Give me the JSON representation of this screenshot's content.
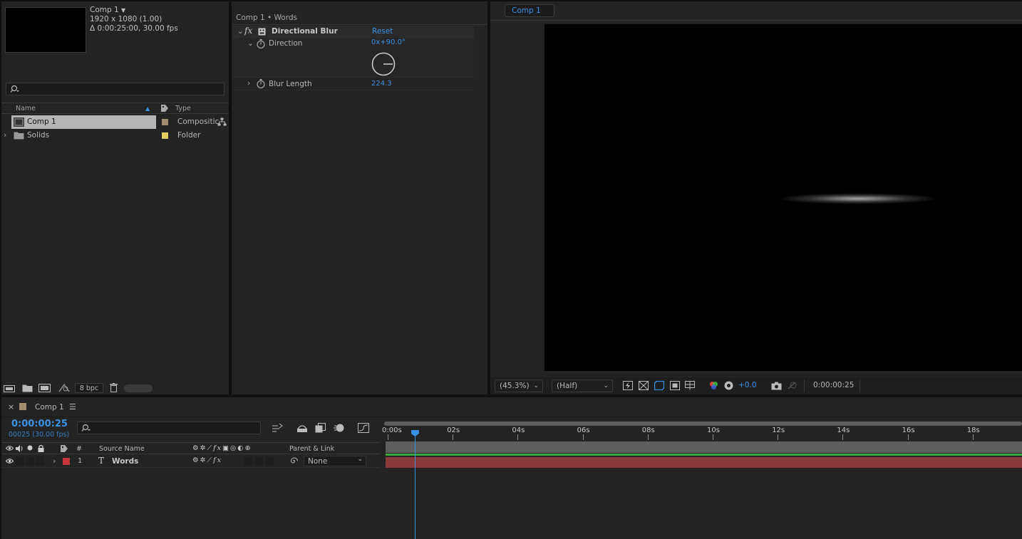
{
  "project": {
    "comp_name": "Comp 1",
    "comp_res": "1920 x 1080 (1.00)",
    "comp_dur": "Δ 0:00:25:00, 30.00 fps",
    "columns": {
      "name": "Name",
      "type": "Type"
    },
    "items": [
      {
        "name": "Comp 1",
        "type": "Compositic",
        "swatch": "#a08c6e"
      },
      {
        "name": "Solids",
        "type": "Folder",
        "swatch": "#e0d060"
      }
    ],
    "bpc": "8 bpc"
  },
  "effects": {
    "header": "Comp 1 • Words",
    "effect_name": "Directional Blur",
    "reset": "Reset",
    "direction_label": "Direction",
    "direction_value": "0x+90.0°",
    "blur_length_label": "Blur Length",
    "blur_length_value": "224.3"
  },
  "viewer": {
    "tab": "Comp 1",
    "zoom": "(45.3%)",
    "resolution": "(Half)",
    "exposure": "+0.0",
    "timecode": "0:00:00:25"
  },
  "timeline": {
    "tab": "Comp 1",
    "time": "0:00:00:25",
    "frames": "00025 (30.00 fps)",
    "columns": {
      "num": "#",
      "source": "Source Name",
      "parent": "Parent & Link"
    },
    "layer": {
      "num": "1",
      "name": "Words",
      "parent": "None",
      "color": "#c43a3a"
    },
    "ruler": [
      "0:00s",
      "02s",
      "04s",
      "06s",
      "08s",
      "10s",
      "12s",
      "14s",
      "16s",
      "18s"
    ],
    "playhead_seconds": 0.83
  },
  "icons": [
    "search-icon",
    "fx-icon",
    "stopwatch-icon",
    "eye-icon",
    "speaker-icon",
    "solo-icon",
    "lock-icon",
    "label-icon",
    "trash-icon",
    "folder-icon",
    "composition-icon",
    "camera-icon",
    "color-wheel-icon"
  ]
}
